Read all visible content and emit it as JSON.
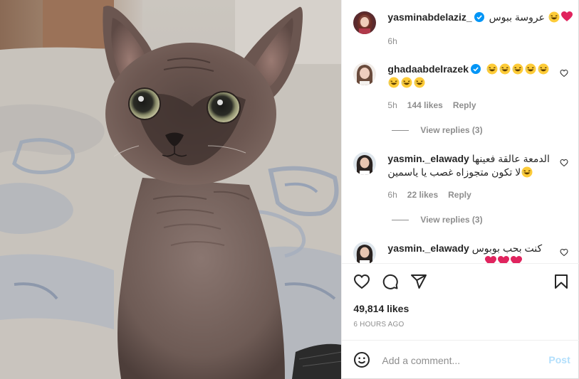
{
  "post": {
    "author": {
      "username": "yasminabdelaziz_",
      "caption": "عروسة ببوس",
      "time": "6h",
      "verified": true
    },
    "comments": [
      {
        "username": "ghadaabdelrazek",
        "verified": true,
        "text_emojis_line1": 5,
        "text_emojis_line2": 3,
        "time": "5h",
        "likes": "144 likes",
        "reply": "Reply",
        "view_replies": "View replies (3)"
      },
      {
        "username": "yasmin._elawady",
        "text_line1": "الدمعة عالقة فعينها",
        "text_line2": "لا تكون متجوزاه غصب يا ياسمين",
        "time": "6h",
        "likes": "22 likes",
        "reply": "Reply",
        "view_replies": "View replies (3)"
      },
      {
        "username": "yasmin._elawady",
        "text_line1": "كنت بحب بوبوس"
      }
    ],
    "likes": "49,814 likes",
    "timestamp": "6 HOURS AGO",
    "add_comment_placeholder": "Add a comment...",
    "post_button": "Post"
  },
  "icons": {
    "heart": "heart-icon",
    "comment": "comment-bubble-icon",
    "share": "paper-plane-icon",
    "save": "bookmark-icon",
    "emoji": "smiley-icon",
    "verified": "verified-badge-icon"
  },
  "colors": {
    "verified_blue": "#0095f6",
    "text_primary": "#262626",
    "text_secondary": "#8e8e8e",
    "post_button_disabled": "#b2dffc",
    "red_heart": "#e0245e"
  }
}
